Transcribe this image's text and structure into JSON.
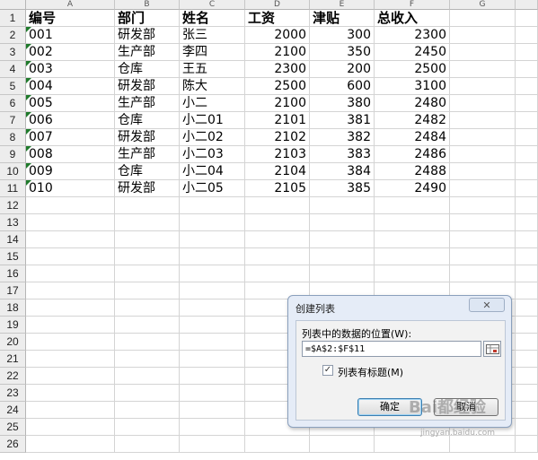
{
  "sheet": {
    "columns": [
      "A",
      "B",
      "C",
      "D",
      "E",
      "F",
      "G"
    ],
    "rows": [
      "1",
      "2",
      "3",
      "4",
      "5",
      "6",
      "7",
      "8",
      "9",
      "10",
      "11",
      "12",
      "13",
      "14",
      "15",
      "16",
      "17",
      "18",
      "19",
      "20",
      "21",
      "22",
      "23",
      "24",
      "25",
      "26"
    ],
    "header_row": [
      "编号",
      "部门",
      "姓名",
      "工资",
      "津贴",
      "总收入"
    ],
    "data_rows": [
      [
        "001",
        "研发部",
        "张三",
        "2000",
        "300",
        "2300"
      ],
      [
        "002",
        "生产部",
        "李四",
        "2100",
        "350",
        "2450"
      ],
      [
        "003",
        "仓库",
        "王五",
        "2300",
        "200",
        "2500"
      ],
      [
        "004",
        "研发部",
        "陈大",
        "2500",
        "600",
        "3100"
      ],
      [
        "005",
        "生产部",
        "小二",
        "2100",
        "380",
        "2480"
      ],
      [
        "006",
        "仓库",
        "小二01",
        "2101",
        "381",
        "2482"
      ],
      [
        "007",
        "研发部",
        "小二02",
        "2102",
        "382",
        "2484"
      ],
      [
        "008",
        "生产部",
        "小二03",
        "2103",
        "383",
        "2486"
      ],
      [
        "009",
        "仓库",
        "小二04",
        "2104",
        "384",
        "2488"
      ],
      [
        "010",
        "研发部",
        "小二05",
        "2105",
        "385",
        "2490"
      ]
    ]
  },
  "dialog": {
    "title": "创建列表",
    "close_label": "✕",
    "range_label": "列表中的数据的位置(W):",
    "range_value": "=$A$2:$F$11",
    "has_headers_label": "列表有标题(M)",
    "has_headers_checked": true,
    "ok_label": "确定",
    "cancel_label": "取消"
  },
  "watermark": {
    "text": "Bai都经验",
    "sub": "jingyan.baidu.com"
  }
}
